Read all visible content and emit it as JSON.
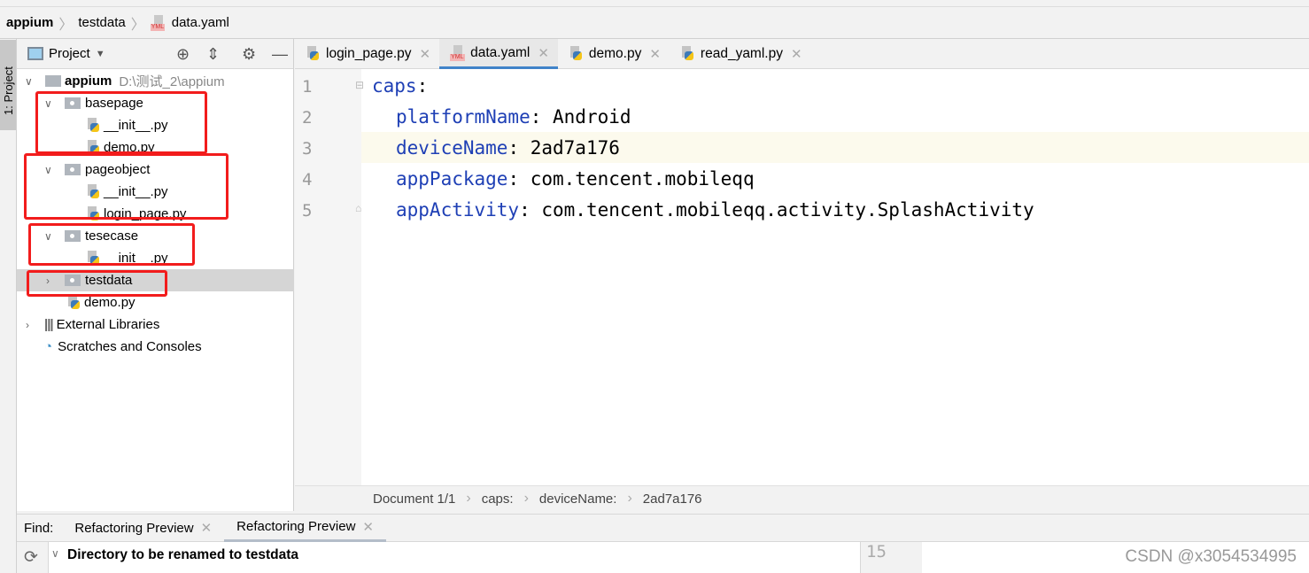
{
  "breadcrumb": {
    "items": [
      "appium",
      "testdata",
      "data.yaml"
    ]
  },
  "side_strip": {
    "project_tab": "1: Project"
  },
  "project_panel": {
    "title": "Project",
    "tree": [
      {
        "label": "appium",
        "path": "D:\\测试_2\\appium",
        "icon": "folder-icon",
        "expanded": true
      },
      {
        "label": "basepage",
        "icon": "package-icon",
        "expanded": true
      },
      {
        "label": "__init__.py",
        "icon": "python-file-icon"
      },
      {
        "label": "demo.py",
        "icon": "python-file-icon"
      },
      {
        "label": "pageobject",
        "icon": "package-icon",
        "expanded": true
      },
      {
        "label": "__init__.py",
        "icon": "python-file-icon"
      },
      {
        "label": "login_page.py",
        "icon": "python-file-icon"
      },
      {
        "label": "tesecase",
        "icon": "package-icon",
        "expanded": true
      },
      {
        "label": "__init__.py",
        "icon": "python-file-icon"
      },
      {
        "label": "testdata",
        "icon": "package-icon",
        "expanded": false,
        "selected": true
      },
      {
        "label": "demo.py",
        "icon": "python-file-icon"
      },
      {
        "label": "External Libraries",
        "icon": "library-icon",
        "expanded": false
      },
      {
        "label": "Scratches and Consoles",
        "icon": "scratches-icon"
      }
    ]
  },
  "editor": {
    "tabs": [
      {
        "label": "login_page.py"
      },
      {
        "label": "data.yaml",
        "active": true
      },
      {
        "label": "demo.py"
      },
      {
        "label": "read_yaml.py"
      }
    ],
    "lines": [
      {
        "n": "1",
        "key": "caps",
        "value": ""
      },
      {
        "n": "2",
        "key": "platformName",
        "value": "Android"
      },
      {
        "n": "3",
        "key": "deviceName",
        "value": "2ad7a176"
      },
      {
        "n": "4",
        "key": "appPackage",
        "value": "com.tencent.mobileqq"
      },
      {
        "n": "5",
        "key": "appActivity",
        "value": "com.tencent.mobileqq.activity.SplashActivity"
      }
    ],
    "status_path": [
      "Document 1/1",
      "caps:",
      "deviceName:",
      "2ad7a176"
    ]
  },
  "find": {
    "label": "Find:",
    "tabs": [
      "Refactoring Preview",
      "Refactoring Preview"
    ],
    "result_header": "Directory to be renamed to testdata",
    "line_number": "15"
  },
  "watermark": "CSDN @x3054534995",
  "colors": {
    "highlight_box": "#f21c1c",
    "yaml_key": "#1e3fb5",
    "active_tab_underline": "#4083c9"
  }
}
